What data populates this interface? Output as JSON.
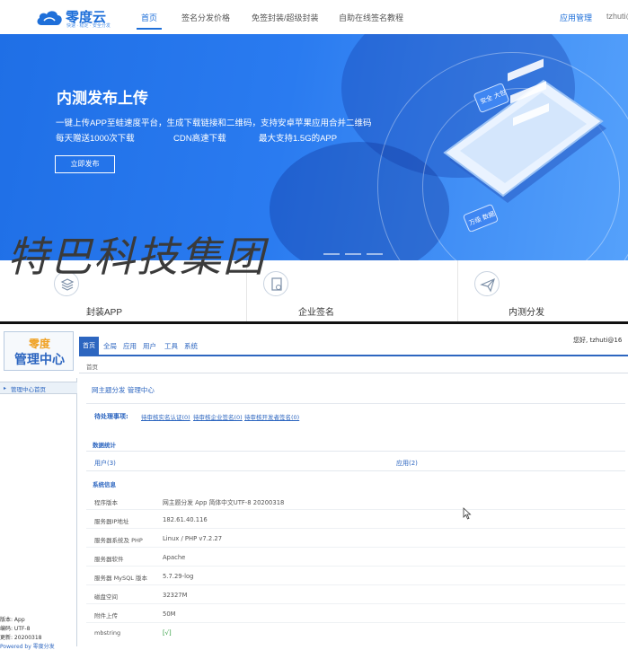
{
  "top_site": {
    "logo": {
      "name": "零度云",
      "tagline": "快速 · 稳定 · 安全分发"
    },
    "nav": [
      {
        "label": "首页",
        "active": true
      },
      {
        "label": "签名分发价格",
        "active": false
      },
      {
        "label": "免签封装/超级封装",
        "active": false
      },
      {
        "label": "自助在线签名教程",
        "active": false
      }
    ],
    "nav_right": {
      "app_manage": "应用管理",
      "user": "tzhuti@"
    },
    "hero": {
      "title": "内测发布上传",
      "line1": "一键上传APP至蛙速度平台，生成下载链接和二维码，支持安卓苹果应用合并二维码",
      "line2_parts": [
        "每天赠送1000次下载",
        "CDN高速下载",
        "最大支持1.5G的APP"
      ],
      "button": "立即发布",
      "art_text1": "安全 大包",
      "art_text2": "万级 数据"
    },
    "cards": [
      {
        "label": "封装APP",
        "icon": "layers-icon"
      },
      {
        "label": "企业签名",
        "icon": "certificate-icon"
      },
      {
        "label": "内测分发",
        "icon": "paper-plane-icon"
      }
    ],
    "colors": {
      "brand": "#1e6fd9",
      "hero_start": "#1f6fe6",
      "hero_end": "#55a1fb"
    }
  },
  "watermark": "特巴科技集团",
  "admin": {
    "logo_line1": "零度",
    "logo_line2": "管理中心",
    "tabs": [
      "首页",
      "全局",
      "应用",
      "用户",
      "工具",
      "系统"
    ],
    "greeting": "您好, tzhuti@16",
    "breadcrumb": "首页",
    "sidebar": {
      "item": "管理中心首页",
      "footer": [
        "版本: App",
        "编码: UTF-8",
        "更新: 20200318",
        "Powered by 零度分发"
      ]
    },
    "main_title": "网主题分发 管理中心",
    "pending": {
      "label": "待处理事项:",
      "links": [
        "待审核实名认证(0)",
        "待审核企业签名(0)",
        "待审核开发者签名(0)"
      ]
    },
    "stats_title": "数据统计",
    "stats": [
      {
        "label": "用户(3)"
      },
      {
        "label": "应用(2)"
      }
    ],
    "sysinfo_title": "系统信息",
    "sysinfo": [
      {
        "label": "程序版本",
        "value": "网主题分发 App 简体中文UTF-8 20200318"
      },
      {
        "label": "服务器IP地址",
        "value": "182.61.40.116"
      },
      {
        "label": "服务器系统及 PHP",
        "value": "Linux / PHP v7.2.27"
      },
      {
        "label": "服务器软件",
        "value": "Apache"
      },
      {
        "label": "服务器 MySQL 版本",
        "value": "5.7.29-log"
      },
      {
        "label": "磁盘空间",
        "value": "32327M"
      },
      {
        "label": "附件上传",
        "value": "50M"
      },
      {
        "label": "mbstring",
        "value": "[√]"
      }
    ],
    "colors": {
      "accent": "#2d66c0",
      "logo_orange": "#f0a020"
    }
  }
}
